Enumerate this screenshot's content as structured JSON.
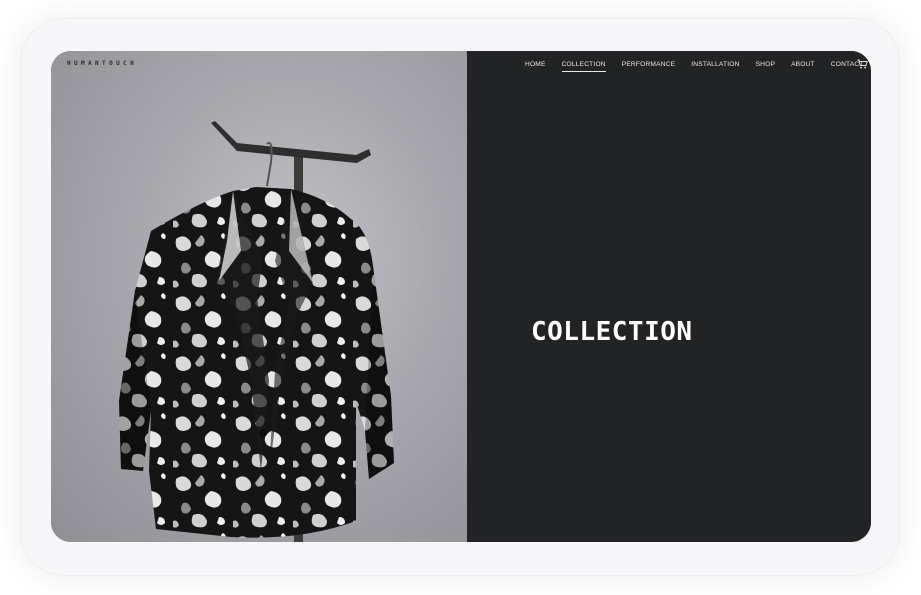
{
  "brand": {
    "logo_text": "HUMANTOUCH"
  },
  "nav": {
    "items": [
      {
        "label": "HOME",
        "active": false
      },
      {
        "label": "COLLECTION",
        "active": true
      },
      {
        "label": "PERFORMANCE",
        "active": false
      },
      {
        "label": "INSTALLATION",
        "active": false
      },
      {
        "label": "SHOP",
        "active": false
      },
      {
        "label": "ABOUT",
        "active": false
      },
      {
        "label": "CONTACT",
        "active": false
      }
    ],
    "cart_icon": "cart-icon"
  },
  "hero": {
    "heading": "COLLECTION"
  },
  "colors": {
    "dark_panel": "#222324",
    "photo_bg": "#a7a7ad",
    "text": "#ffffff"
  }
}
